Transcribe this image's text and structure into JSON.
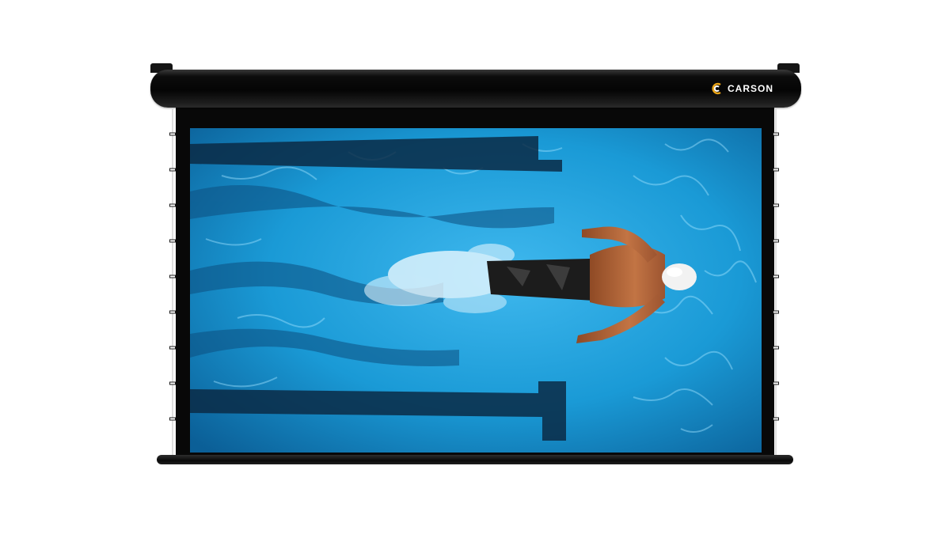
{
  "screen": {
    "brand": "CARSON",
    "housing_color": "#0a0a0a",
    "logo_accent_color": "#e8a317",
    "icons": [
      "carson-logo-icon"
    ]
  },
  "projected_image": {
    "water_color": "#1a9ad6",
    "subject_skin_color": "#b5663c",
    "cap_color": "#f2f2f2",
    "trunks_color": "#1c1c1c"
  }
}
